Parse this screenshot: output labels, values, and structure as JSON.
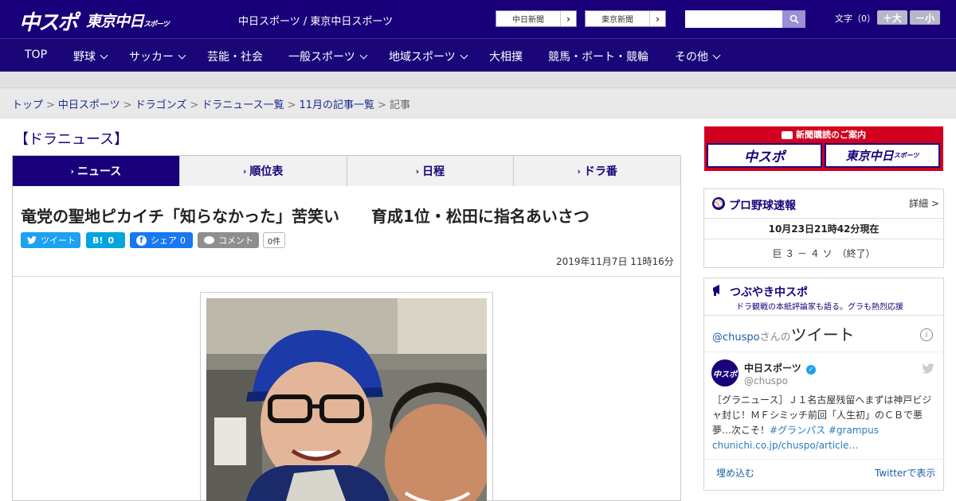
{
  "header": {
    "logo_main": "中スポ",
    "logo_sub": "東京中日",
    "logo_sub_small": "スポーツ",
    "site_name": "中日スポーツ / 東京中日スポーツ",
    "paper_links": [
      "中日新聞",
      "東京新聞"
    ],
    "fontsize_label": "文字（0）",
    "fontsize_up": "＋大",
    "fontsize_down": "－小"
  },
  "nav": {
    "items": [
      {
        "label": "TOP",
        "chevron": false
      },
      {
        "label": "野球",
        "chevron": true
      },
      {
        "label": "サッカー",
        "chevron": true
      },
      {
        "label": "芸能・社会",
        "chevron": false
      },
      {
        "label": "一般スポーツ",
        "chevron": true
      },
      {
        "label": "地域スポーツ",
        "chevron": true
      },
      {
        "label": "大相撲",
        "chevron": false
      },
      {
        "label": "競馬・ボート・競輪",
        "chevron": false
      },
      {
        "label": "その他",
        "chevron": true
      }
    ]
  },
  "breadcrumb": {
    "items": [
      "トップ",
      "中日スポーツ",
      "ドラゴンズ",
      "ドラニュース一覧",
      "11月の記事一覧"
    ],
    "current": "記事",
    "sep": ">"
  },
  "section_title": "【ドラニュース】",
  "tabs": [
    {
      "label": "ニュース",
      "active": true
    },
    {
      "label": "順位表",
      "active": false
    },
    {
      "label": "日程",
      "active": false
    },
    {
      "label": "ドラ番",
      "active": false
    }
  ],
  "article": {
    "headline": "竜党の聖地ピカイチ「知らなかった」苦笑い　　育成1位・松田に指名あいさつ",
    "share": {
      "tweet": "ツイート",
      "hatena": "B!",
      "hatena_count": "0",
      "facebook": "シェア",
      "facebook_count": "0",
      "comment": "コメント",
      "comment_count": "0件"
    },
    "date": "2019年11月7日 11時16分"
  },
  "sidebar": {
    "subscribe": {
      "title": "新聞購読のご案内",
      "buttons": [
        "中スポ",
        "東京中日"
      ],
      "button_small": "スポーツ"
    },
    "baseball": {
      "title": "プロ野球速報",
      "detail": "詳細 >",
      "timestamp": "10月23日21時42分現在",
      "score": "巨 ３ － ４ ソ　（終了）"
    },
    "tweets": {
      "title": "つぶやき中スポ",
      "subtitle": "ドラ観戦の本紙評論家も語る。グラも熱烈応援",
      "handle_prefix": "@chuspo",
      "handle_suffix": "さんの",
      "tweet_word": "ツイート",
      "user_name": "中日スポーツ",
      "user_handle": "@chuspo",
      "text": "［グラニュース］Ｊ１名古屋残留へまずは神戸ビジャ封じ！ＭＦシミッチ前回「人生初」のＣＢで悪夢…次こそ！",
      "hashtags": "#グランパス #grampus",
      "link": "chunichi.co.jp/chuspo/article…",
      "embed": "埋め込む",
      "view_on": "Twitterで表示"
    }
  },
  "colors": {
    "brand": "#19007a",
    "accent_red": "#d2001f",
    "twitter": "#1da1f2",
    "facebook": "#1877f2",
    "hatena": "#00a4de"
  }
}
